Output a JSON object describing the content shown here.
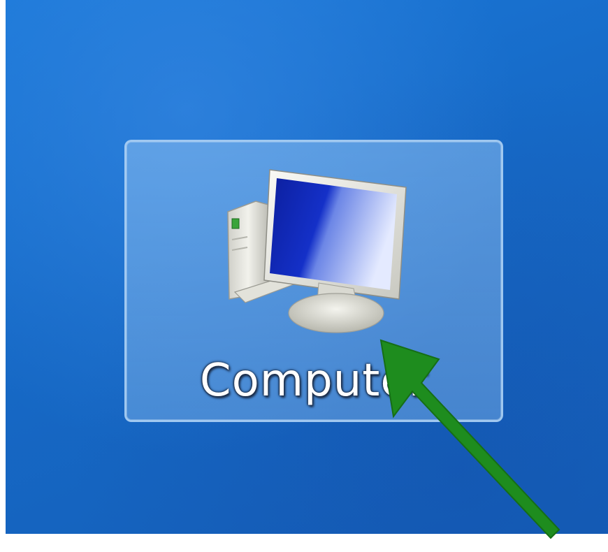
{
  "desktop": {
    "icon": {
      "label": "Computer",
      "icon_name": "computer-icon",
      "selected": true
    },
    "annotation": {
      "icon_name": "arrow-icon",
      "color": "#1e8c1e"
    }
  },
  "colors": {
    "desktop_background": "#1669c6",
    "selection_fill": "#7cb0e6",
    "selection_border": "#afd2f5"
  }
}
